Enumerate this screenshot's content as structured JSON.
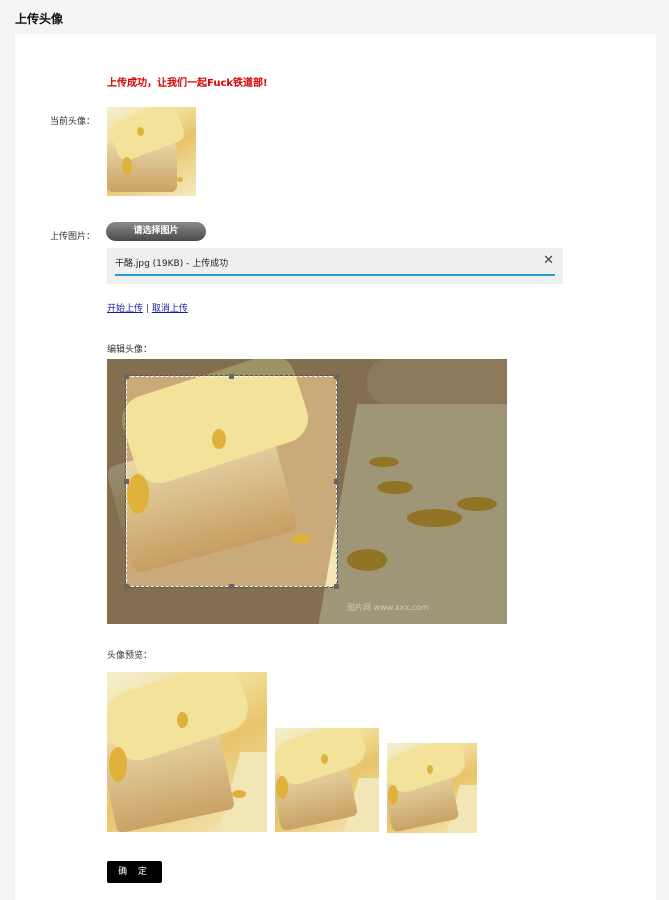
{
  "page": {
    "title": "上传头像"
  },
  "message": "上传成功，让我们一起Fuck铁道部!",
  "current_avatar": {
    "label": "当前头像："
  },
  "upload": {
    "label": "上传图片：",
    "choose_button": "请选择图片",
    "file_status": "干酪.jpg (19KB) - 上传成功",
    "start_link": "开始上传",
    "separator": "|",
    "cancel_link": "取消上传"
  },
  "crop": {
    "label": "编辑头像：",
    "watermark": "图片网 www.xxx.com"
  },
  "preview": {
    "label": "头像预览："
  },
  "confirm_button": "确 定",
  "colors": {
    "error": "#d60000",
    "progress": "#2a9bd8",
    "button": "#000000"
  }
}
